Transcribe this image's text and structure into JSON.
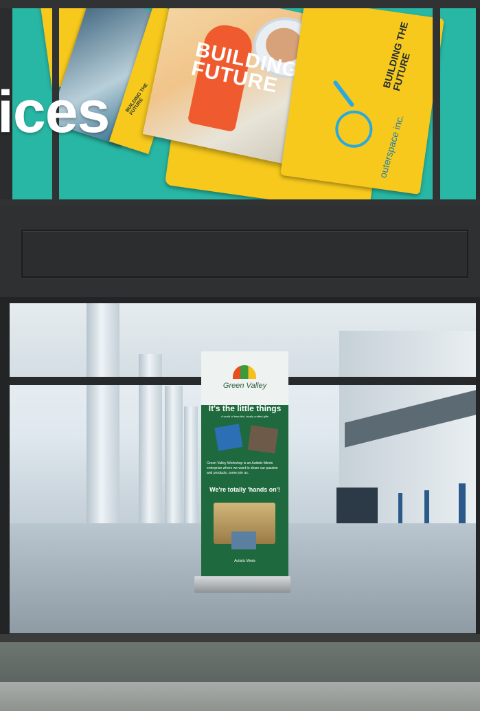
{
  "scene": {
    "headline_fragment": "ices",
    "poster": {
      "headline": "BUILDING FUTURE",
      "side_text": "BUILDING THE FUTURE",
      "small_card_text": "BUILDING THE FUTURE",
      "brand": "outerspace inc."
    },
    "banner": {
      "brand": "Green Valley",
      "headline": "It's the little things",
      "subhead": "A world of beautiful, locally crafted gifts",
      "body": "Green Valley Workshop is an Autistic Minds enterprise where we want to share our passion and products, come join us.",
      "tagline": "We're totally 'hands on'!",
      "footer_brand": "Autistic Minds"
    }
  },
  "colors": {
    "teal": "#28b7a4",
    "yellow": "#f7c91d",
    "frame": "#2a2c2d",
    "banner_green": "#1e6a3e"
  }
}
